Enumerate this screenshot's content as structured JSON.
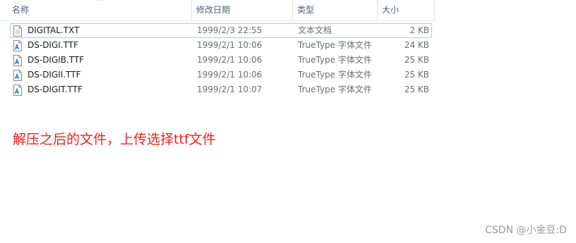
{
  "header": {
    "columns": {
      "name": "名称",
      "date": "修改日期",
      "type": "类型",
      "size": "大小"
    },
    "sort_indicator": "^"
  },
  "files": [
    {
      "name": "DIGITAL.TXT",
      "date": "1999/2/3 22:55",
      "type": "文本文档",
      "size": "2 KB",
      "icon": "text-file-icon",
      "selected": true
    },
    {
      "name": "DS-DIGI.TTF",
      "date": "1999/2/1 10:06",
      "type": "TrueType 字体文件",
      "size": "24 KB",
      "icon": "font-file-icon",
      "selected": false
    },
    {
      "name": "DS-DIGIB.TTF",
      "date": "1999/2/1 10:06",
      "type": "TrueType 字体文件",
      "size": "25 KB",
      "icon": "font-file-icon",
      "selected": false
    },
    {
      "name": "DS-DIGII.TTF",
      "date": "1999/2/1 10:06",
      "type": "TrueType 字体文件",
      "size": "25 KB",
      "icon": "font-file-icon",
      "selected": false
    },
    {
      "name": "DS-DIGIT.TTF",
      "date": "1999/2/1 10:07",
      "type": "TrueType 字体文件",
      "size": "25 KB",
      "icon": "font-file-icon",
      "selected": false
    }
  ],
  "caption": "解压之后的文件，上传选择ttf文件",
  "watermark": "CSDN @小金豆:D",
  "colors": {
    "caption": "#ff1a1a",
    "selection_border": "#99d1ff",
    "header_text": "#4c607a"
  }
}
